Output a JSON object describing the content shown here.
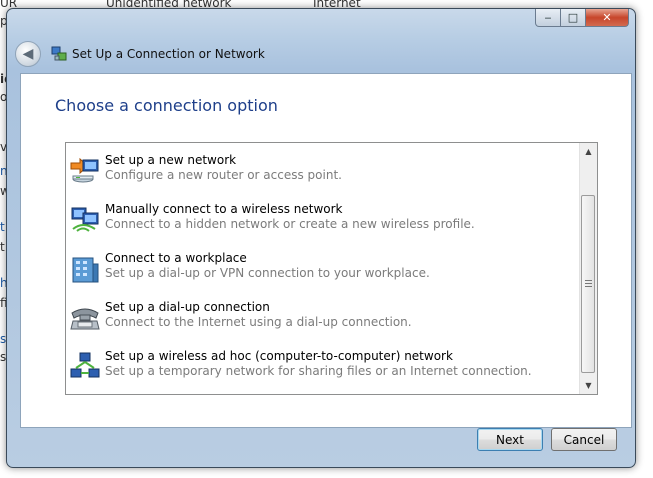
{
  "background": {
    "row_text": [
      "Unidentified network",
      "Internet"
    ],
    "edge_fragments": [
      "UR",
      "p",
      "id",
      "ol",
      "vo",
      "n",
      "w",
      "t",
      "t",
      "h",
      "fil",
      "s",
      "se"
    ]
  },
  "window": {
    "title": "Set Up a Connection or Network",
    "caption": {
      "minimize": "‒",
      "maximize": "□",
      "close": "✕"
    }
  },
  "main": {
    "heading": "Choose a connection option",
    "options": [
      {
        "title": "Set up a new network",
        "description": "Configure a new router or access point.",
        "icon": "router-setup-icon"
      },
      {
        "title": "Manually connect to a wireless network",
        "description": "Connect to a hidden network or create a new wireless profile.",
        "icon": "wireless-network-icon"
      },
      {
        "title": "Connect to a workplace",
        "description": "Set up a dial-up or VPN connection to your workplace.",
        "icon": "workplace-building-icon"
      },
      {
        "title": "Set up a dial-up connection",
        "description": "Connect to the Internet using a dial-up connection.",
        "icon": "dialup-phone-icon"
      },
      {
        "title": "Set up a wireless ad hoc (computer-to-computer) network",
        "description": "Set up a temporary network for sharing files or an Internet connection.",
        "icon": "adhoc-network-icon"
      }
    ]
  },
  "footer": {
    "next_label": "Next",
    "cancel_label": "Cancel"
  },
  "colors": {
    "heading": "#1e3f8a",
    "description": "#7b7b7b",
    "default_button_border": "#3c7fb1"
  }
}
